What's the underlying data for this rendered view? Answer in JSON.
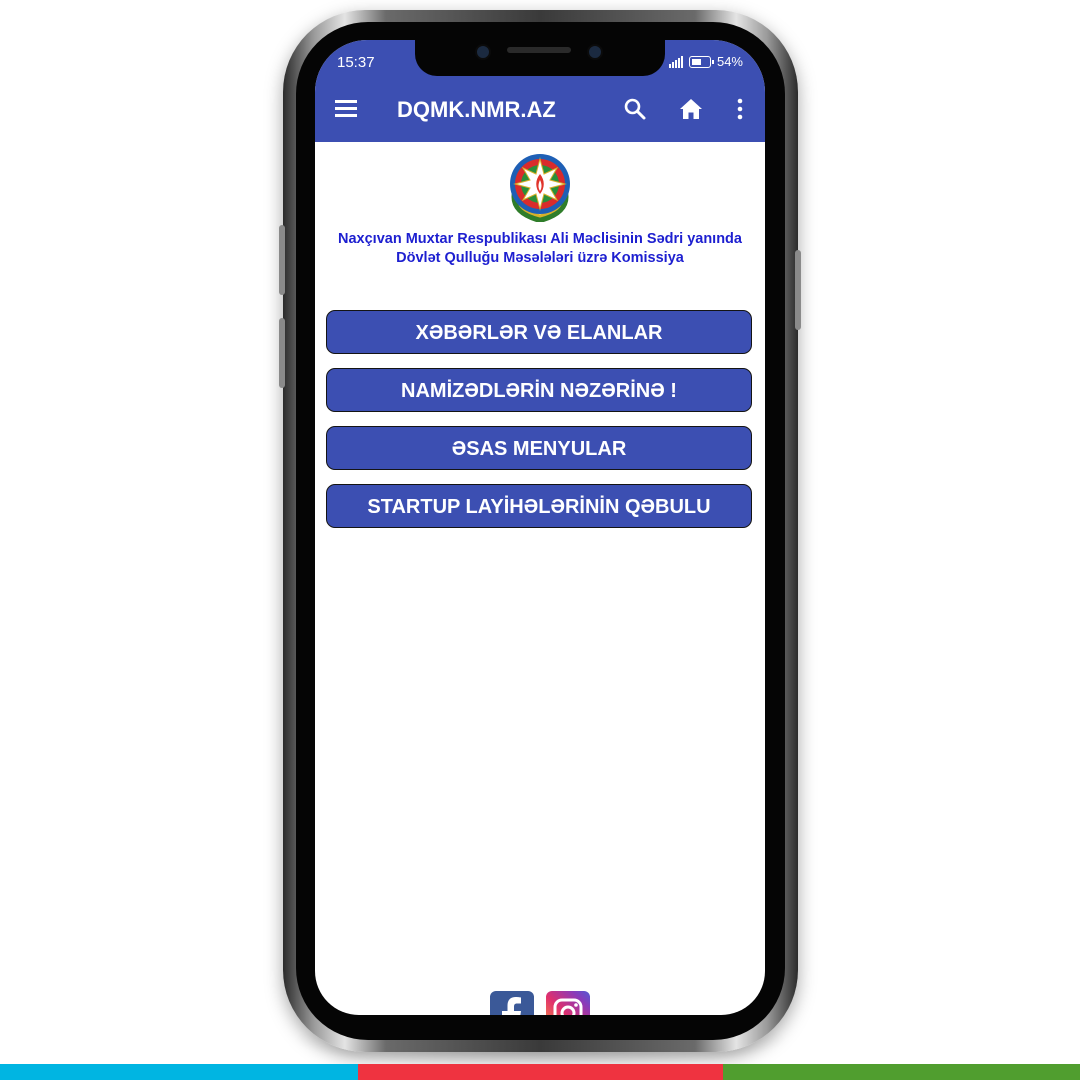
{
  "status_bar": {
    "time": "15:37",
    "battery": "54%"
  },
  "app_bar": {
    "title": "DQMK.NMR.AZ",
    "icons": [
      "menu-icon",
      "search-icon",
      "home-icon",
      "more-vert-icon"
    ]
  },
  "organization": {
    "line1": "Naxçıvan Muxtar Respublikası Ali Məclisinin Sədri yanında",
    "line2": "Dövlət Qulluğu Məsələləri üzrə Komissiya"
  },
  "menu": [
    {
      "label": "XƏBƏRLƏR VƏ ELANLAR"
    },
    {
      "label": "NAMİZƏDLƏRİN NƏZƏRİNƏ !"
    },
    {
      "label": "ƏSAS MENYULAR"
    },
    {
      "label": "STARTUP LAYİHƏLƏRİNİN QƏBULU"
    }
  ],
  "social": [
    "facebook-icon",
    "instagram-icon"
  ],
  "colors": {
    "primary": "#3c4fb2",
    "org_text": "#1d1fd0",
    "flag_blue": "#00b5e2",
    "flag_red": "#ef3340",
    "flag_green": "#509e2f"
  }
}
